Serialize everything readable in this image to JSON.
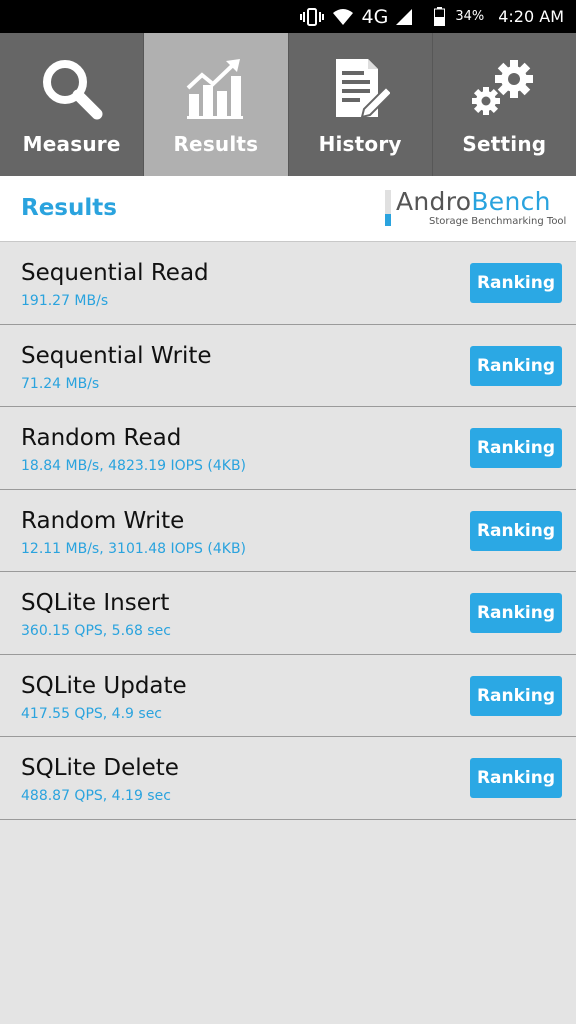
{
  "status_bar": {
    "battery_percent": "34%",
    "clock": "4:20 AM",
    "network": "4G",
    "icons": [
      "vibrate-icon",
      "wifi-icon",
      "signal-icon",
      "battery-icon"
    ]
  },
  "tabs": [
    {
      "label": "Measure",
      "icon": "magnifier-icon",
      "active": false
    },
    {
      "label": "Results",
      "icon": "bar-chart-icon",
      "active": true
    },
    {
      "label": "History",
      "icon": "document-pencil-icon",
      "active": false
    },
    {
      "label": "Setting",
      "icon": "gears-icon",
      "active": false
    }
  ],
  "header": {
    "title": "Results",
    "brand_name_part1": "Andro",
    "brand_name_part2": "Bench",
    "brand_tagline": "Storage Benchmarking Tool"
  },
  "results": [
    {
      "name": "Sequential Read",
      "value": "191.27 MB/s",
      "button": "Ranking"
    },
    {
      "name": "Sequential Write",
      "value": "71.24 MB/s",
      "button": "Ranking"
    },
    {
      "name": "Random Read",
      "value": "18.84 MB/s, 4823.19 IOPS (4KB)",
      "button": "Ranking"
    },
    {
      "name": "Random Write",
      "value": "12.11 MB/s, 3101.48 IOPS (4KB)",
      "button": "Ranking"
    },
    {
      "name": "SQLite Insert",
      "value": "360.15 QPS, 5.68 sec",
      "button": "Ranking"
    },
    {
      "name": "SQLite Update",
      "value": "417.55 QPS, 4.9 sec",
      "button": "Ranking"
    },
    {
      "name": "SQLite Delete",
      "value": "488.87 QPS, 4.19 sec",
      "button": "Ranking"
    }
  ],
  "colors": {
    "accent": "#2aa3de",
    "button": "#2ba8e4",
    "tab_bg": "#666666",
    "tab_active_bg": "#b0b0b0",
    "list_bg": "#e4e4e4"
  }
}
